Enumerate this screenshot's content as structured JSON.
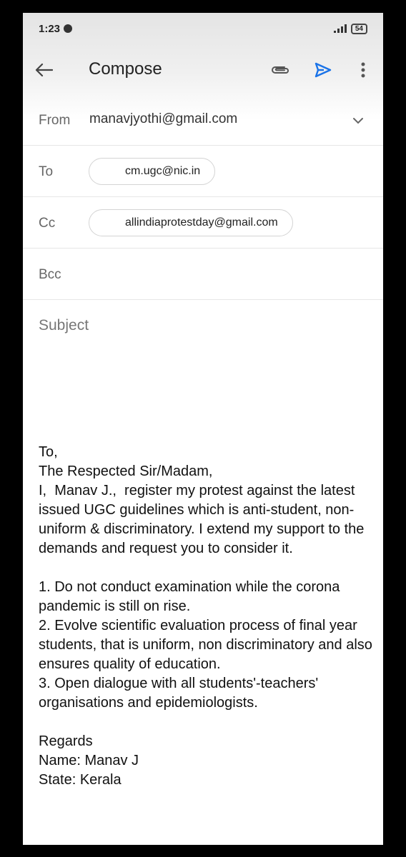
{
  "status_bar": {
    "time": "1:23",
    "battery": "54"
  },
  "app_bar": {
    "title": "Compose"
  },
  "from": {
    "label": "From",
    "value": "manavjyothi@gmail.com"
  },
  "to": {
    "label": "To",
    "chip": "cm.ugc@nic.in"
  },
  "cc": {
    "label": "Cc",
    "chip": "allindiaprotestday@gmail.com"
  },
  "bcc": {
    "label": "Bcc"
  },
  "subject": {
    "placeholder": "Subject"
  },
  "body": {
    "lines": [
      "To,",
      "The Respected Sir/Madam,",
      "I,  Manav J.,  register my protest against the latest issued UGC guidelines which is anti-student, non-uniform & discriminatory. I extend my support to the demands and request you to consider it.",
      "",
      "1. Do not conduct examination while the corona pandemic is still on rise.",
      "2. Evolve scientific evaluation process of final year students, that is uniform, non discriminatory and also ensures quality of education.",
      "3. Open dialogue with all students'-teachers' organisations and epidemiologists.",
      "",
      "Regards",
      "Name: Manav J",
      "State: Kerala"
    ]
  },
  "colors": {
    "accent": "#1a73e8",
    "icon": "#5f6368"
  }
}
